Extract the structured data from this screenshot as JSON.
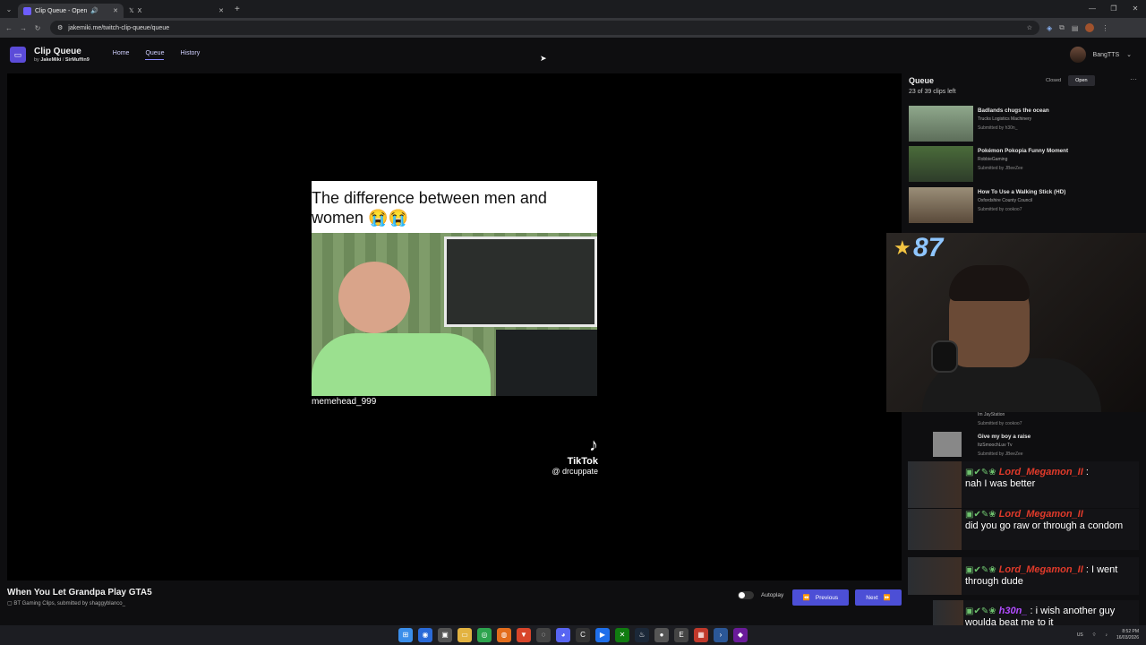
{
  "browser": {
    "tabs": [
      {
        "label": "Clip Queue - Open",
        "close": "✕"
      },
      {
        "label": "X",
        "close": "✕"
      }
    ],
    "new_tab": "+",
    "url": "jakemiki.me/twitch-clip-queue/queue"
  },
  "app": {
    "title": "Clip Queue",
    "by": "by",
    "author1": "JakeMiki",
    "sep": "/",
    "author2": "SirMuffin9",
    "nav": [
      "Home",
      "Queue",
      "History"
    ],
    "username": "BangTTS"
  },
  "video": {
    "caption": "The difference between men and women 😭😭",
    "handle": "memehead_999",
    "brand": "TikTok",
    "brand_handle": "@ drcuppate"
  },
  "clip": {
    "title": "When You Let Grandpa Play GTA5",
    "channel": "BT Gaming Clips",
    "submitted": ", submitted by shaggyblanco_"
  },
  "controls": {
    "autoplay": "Autoplay",
    "previous": "Previous",
    "next": "Next"
  },
  "queue": {
    "title": "Queue",
    "count": "23 of 39 clips left",
    "closed": "Closed",
    "open": "Open",
    "more": "···",
    "items": [
      {
        "title": "Badlands chugs the ocean",
        "channel": "Trucks Logistics Machinery",
        "by": "Submitted by h30n_"
      },
      {
        "title": "Pokémon Pokopia Funny Moment",
        "channel": "RobbieGaming",
        "by": "Submitted by JBeeZee"
      },
      {
        "title": "How To Use a Walking Stick (HD)",
        "channel": "Oxfordshire County Council",
        "by": "Submitted by cookoo7"
      },
      {
        "title": "",
        "channel": "Im JayStation",
        "by": "Submitted by cookoo7"
      },
      {
        "title": "Give my boy a raise",
        "channel": "ItzSmoochLuv Tv",
        "by": "Submitted by JBeeZee"
      }
    ]
  },
  "stream": {
    "points": "87"
  },
  "chat": [
    {
      "user": "Lord_Megamon_II",
      "text": "nah I was better"
    },
    {
      "user": "Lord_Megamon_II",
      "text": "did you go raw or through a condom"
    },
    {
      "user": "Lord_Megamon_II",
      "text": "I went through dude"
    },
    {
      "user": "h30n_",
      "text": "i wish another guy woulda beat me to it"
    }
  ],
  "tray": {
    "lang": "US",
    "time": "8:52 PM",
    "date": "16/03/2026"
  }
}
